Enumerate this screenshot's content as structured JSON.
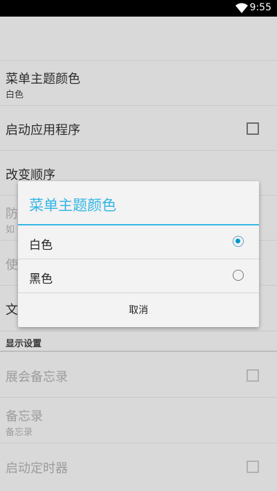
{
  "status_bar": {
    "time": "9:55",
    "wifi_icon": "wifi-icon"
  },
  "settings": {
    "items": [
      {
        "title": "菜单主题颜色",
        "summary": "白色"
      },
      {
        "title": "启动应用程序"
      },
      {
        "title": "改变顺序"
      },
      {
        "title": "防",
        "summary": "如"
      },
      {
        "title": "使"
      },
      {
        "title": "文"
      }
    ],
    "section_header": "显示设置",
    "display_items": [
      {
        "title": "展会备忘录"
      },
      {
        "title": "备忘录",
        "summary": "备忘录"
      },
      {
        "title": "启动定时器"
      }
    ]
  },
  "dialog": {
    "title": "菜单主题颜色",
    "options": [
      {
        "label": "白色",
        "selected": true
      },
      {
        "label": "黑色",
        "selected": false
      }
    ],
    "cancel_label": "取消",
    "accent_color": "#33b5e5"
  }
}
